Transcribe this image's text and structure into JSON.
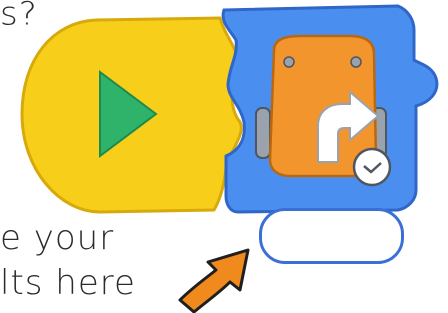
{
  "question": {
    "text": "s?"
  },
  "prompt": {
    "line1": "e your",
    "line2": "lts here"
  },
  "blocks": {
    "start_block": {
      "color": "#f7cf1a",
      "outline": "#d7a90a",
      "icon": "play-triangle-icon",
      "icon_color": "#2fb36a"
    },
    "move_block": {
      "color": "#4a8ff0",
      "outline": "#2f67c9",
      "icon": "robot-turn-right-icon",
      "robot_color": "#f2952c",
      "arrow_color": "#ffffff",
      "timer_icon": "clock-badge-icon"
    }
  },
  "result_box": {
    "value": ""
  },
  "pointer": {
    "icon": "curved-arrow-icon",
    "color": "#f08a1c"
  }
}
